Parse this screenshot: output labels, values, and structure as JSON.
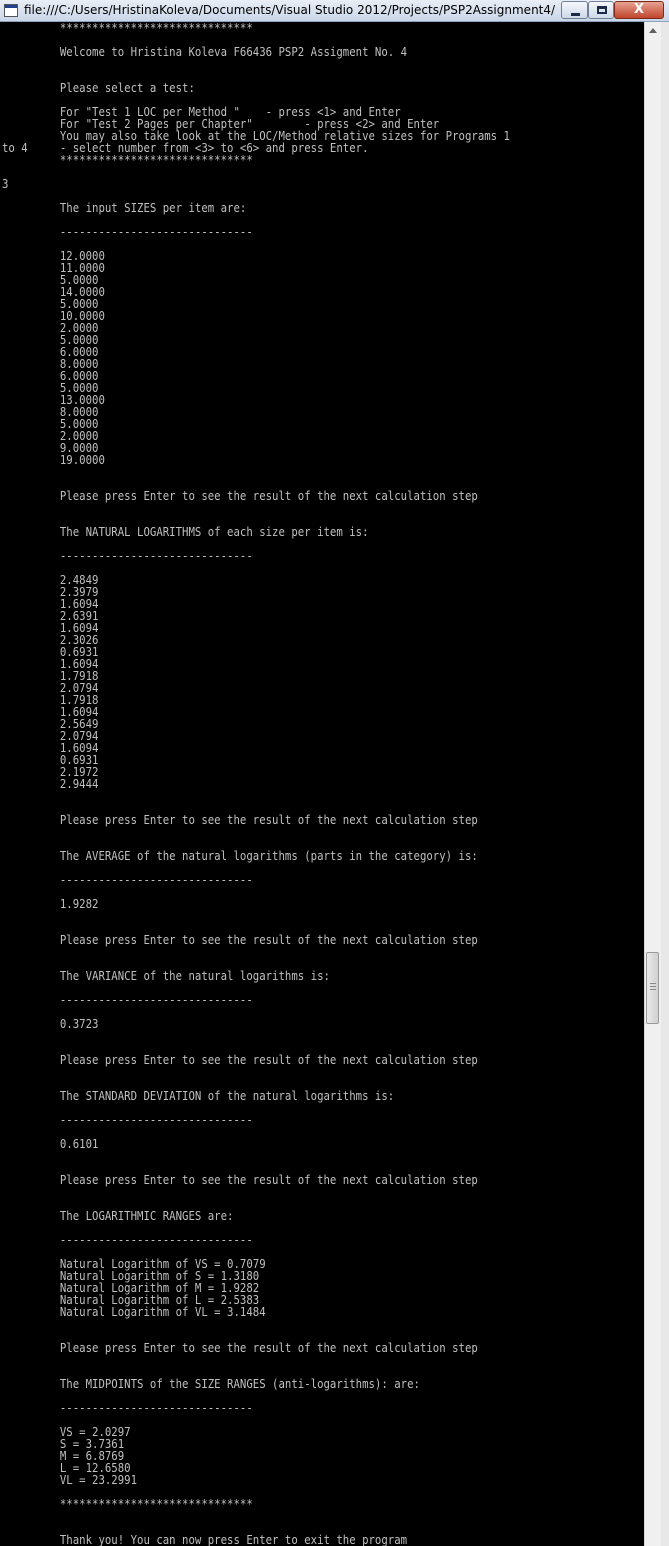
{
  "window": {
    "title": "file:///C:/Users/HristinaKoleva/Documents/Visual Studio 2012/Projects/PSP2Assignment4/PSP2Ass...",
    "close_label": "X"
  },
  "console": {
    "lines": [
      "         ******************************",
      "",
      "         Welcome to Hristina Koleva F66436 PSP2 Assigment No. 4",
      "",
      "",
      "         Please select a test:",
      "",
      "         For \"Test 1 LOC per Method \"    - press <1> and Enter",
      "         For \"Test 2 Pages per Chapter\"        - press <2> and Enter",
      "         You may also take look at the LOC/Method relative sizes for Programs 1",
      "to 4     - select number from <3> to <6> and press Enter.",
      "         ******************************",
      "",
      "3",
      "",
      "         The input SIZES per item are:",
      "",
      "         ------------------------------",
      "",
      "         12.0000",
      "         11.0000",
      "         5.0000",
      "         14.0000",
      "         5.0000",
      "         10.0000",
      "         2.0000",
      "         5.0000",
      "         6.0000",
      "         8.0000",
      "         6.0000",
      "         5.0000",
      "         13.0000",
      "         8.0000",
      "         5.0000",
      "         2.0000",
      "         9.0000",
      "         19.0000",
      "",
      "",
      "         Please press Enter to see the result of the next calculation step",
      "",
      "",
      "         The NATURAL LOGARITHMS of each size per item is:",
      "",
      "         ------------------------------",
      "",
      "         2.4849",
      "         2.3979",
      "         1.6094",
      "         2.6391",
      "         1.6094",
      "         2.3026",
      "         0.6931",
      "         1.6094",
      "         1.7918",
      "         2.0794",
      "         1.7918",
      "         1.6094",
      "         2.5649",
      "         2.0794",
      "         1.6094",
      "         0.6931",
      "         2.1972",
      "         2.9444",
      "",
      "",
      "         Please press Enter to see the result of the next calculation step",
      "",
      "",
      "         The AVERAGE of the natural logarithms (parts in the category) is:",
      "",
      "         ------------------------------",
      "",
      "         1.9282",
      "",
      "",
      "         Please press Enter to see the result of the next calculation step",
      "",
      "",
      "         The VARIANCE of the natural logarithms is:",
      "",
      "         ------------------------------",
      "",
      "         0.3723",
      "",
      "",
      "         Please press Enter to see the result of the next calculation step",
      "",
      "",
      "         The STANDARD DEVIATION of the natural logarithms is:",
      "",
      "         ------------------------------",
      "",
      "         0.6101",
      "",
      "",
      "         Please press Enter to see the result of the next calculation step",
      "",
      "",
      "         The LOGARITHMIC RANGES are:",
      "",
      "         ------------------------------",
      "",
      "         Natural Logarithm of VS = 0.7079",
      "         Natural Logarithm of S = 1.3180",
      "         Natural Logarithm of M = 1.9282",
      "         Natural Logarithm of L = 2.5383",
      "         Natural Logarithm of VL = 3.1484",
      "",
      "",
      "         Please press Enter to see the result of the next calculation step",
      "",
      "",
      "         The MIDPOINTS of the SIZE RANGES (anti-logarithms): are:",
      "",
      "         ------------------------------",
      "",
      "         VS = 2.0297",
      "         S = 3.7361",
      "         M = 6.8769",
      "         L = 12.6580",
      "         VL = 23.2991",
      "",
      "         ******************************",
      "",
      "",
      "         Thank you! You can now press Enter to exit the program"
    ]
  }
}
